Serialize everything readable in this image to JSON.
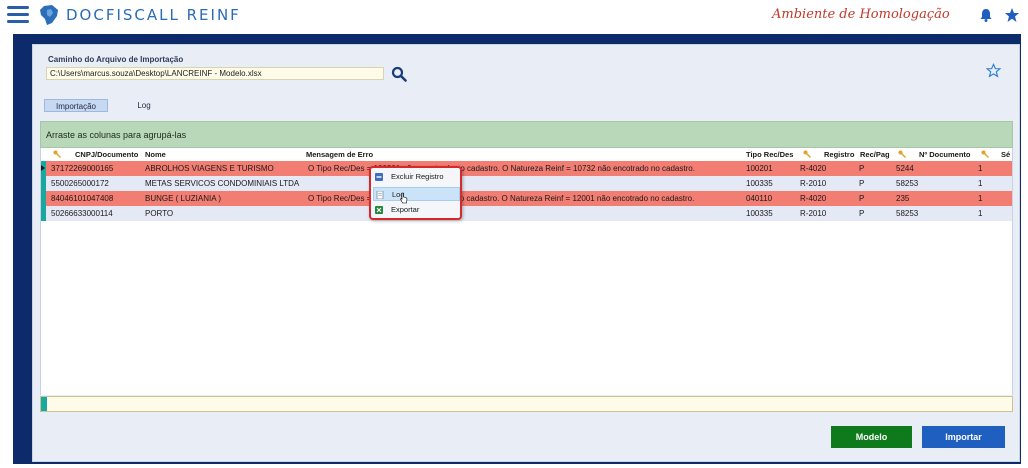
{
  "app": {
    "brand": "DOCFISCALL REINF",
    "environment": "Ambiente de Homologação"
  },
  "import": {
    "path_label": "Caminho do Arquivo de Importação",
    "path_value": "C:\\Users\\marcus.souza\\Desktop\\LANCREINF - Modelo.xlsx"
  },
  "tabs": [
    {
      "label": "Importação",
      "active": true
    },
    {
      "label": "Log",
      "active": false
    }
  ],
  "grid": {
    "group_hint": "Arraste as colunas para agrupá-las",
    "columns": [
      "CNPJ/Documento",
      "Nome",
      "Mensagem de Erro",
      "Tipo Rec/Des",
      "Registro",
      "Rec/Pag",
      "Nº Documento",
      "Sé"
    ],
    "rows": [
      {
        "cnpj": "37172269000165",
        "nome": "ABROLHOS VIAGENS E TURISMO",
        "msg": "O Tipo Rec/Des = 100201 não encotrado no cadastro. O Natureza Reinf = 10732 não encotrado no cadastro.",
        "tipo": "100201",
        "registro": "R-4020",
        "recpag": "P",
        "doc": "5244",
        "serie": "1",
        "status": "error"
      },
      {
        "cnpj": "5500265000172",
        "nome": "METAS SERVICOS CONDOMINIAIS LTDA",
        "msg": "",
        "tipo": "100335",
        "registro": "R-2010",
        "recpag": "P",
        "doc": "58253",
        "serie": "1",
        "status": "ok"
      },
      {
        "cnpj": "84046101047408",
        "nome": "BUNGE ( LUZIANIA )",
        "msg": "O Tipo Rec/Des = 040110 não encotrado no cadastro. O Natureza Reinf = 12001 não encotrado no cadastro.",
        "tipo": "040110",
        "registro": "R-4020",
        "recpag": "P",
        "doc": "235",
        "serie": "1",
        "status": "error"
      },
      {
        "cnpj": "50266633000114",
        "nome": "PORTO",
        "msg": "",
        "tipo": "100335",
        "registro": "R-2010",
        "recpag": "P",
        "doc": "58253",
        "serie": "1",
        "status": "ok"
      }
    ]
  },
  "context_menu": {
    "items": [
      {
        "label": "Excluir Registro",
        "icon": "delete-icon"
      },
      {
        "label": "Log",
        "icon": "document-icon"
      },
      {
        "label": "Exportar",
        "icon": "excel-icon"
      }
    ]
  },
  "buttons": {
    "modelo": "Modelo",
    "importar": "Importar"
  },
  "colors": {
    "error_row": "#f27d72",
    "frame": "#0d2a6b",
    "group_bar": "#b9d7b9",
    "modelo": "#0e7a1c",
    "importar": "#1f5fbf"
  }
}
